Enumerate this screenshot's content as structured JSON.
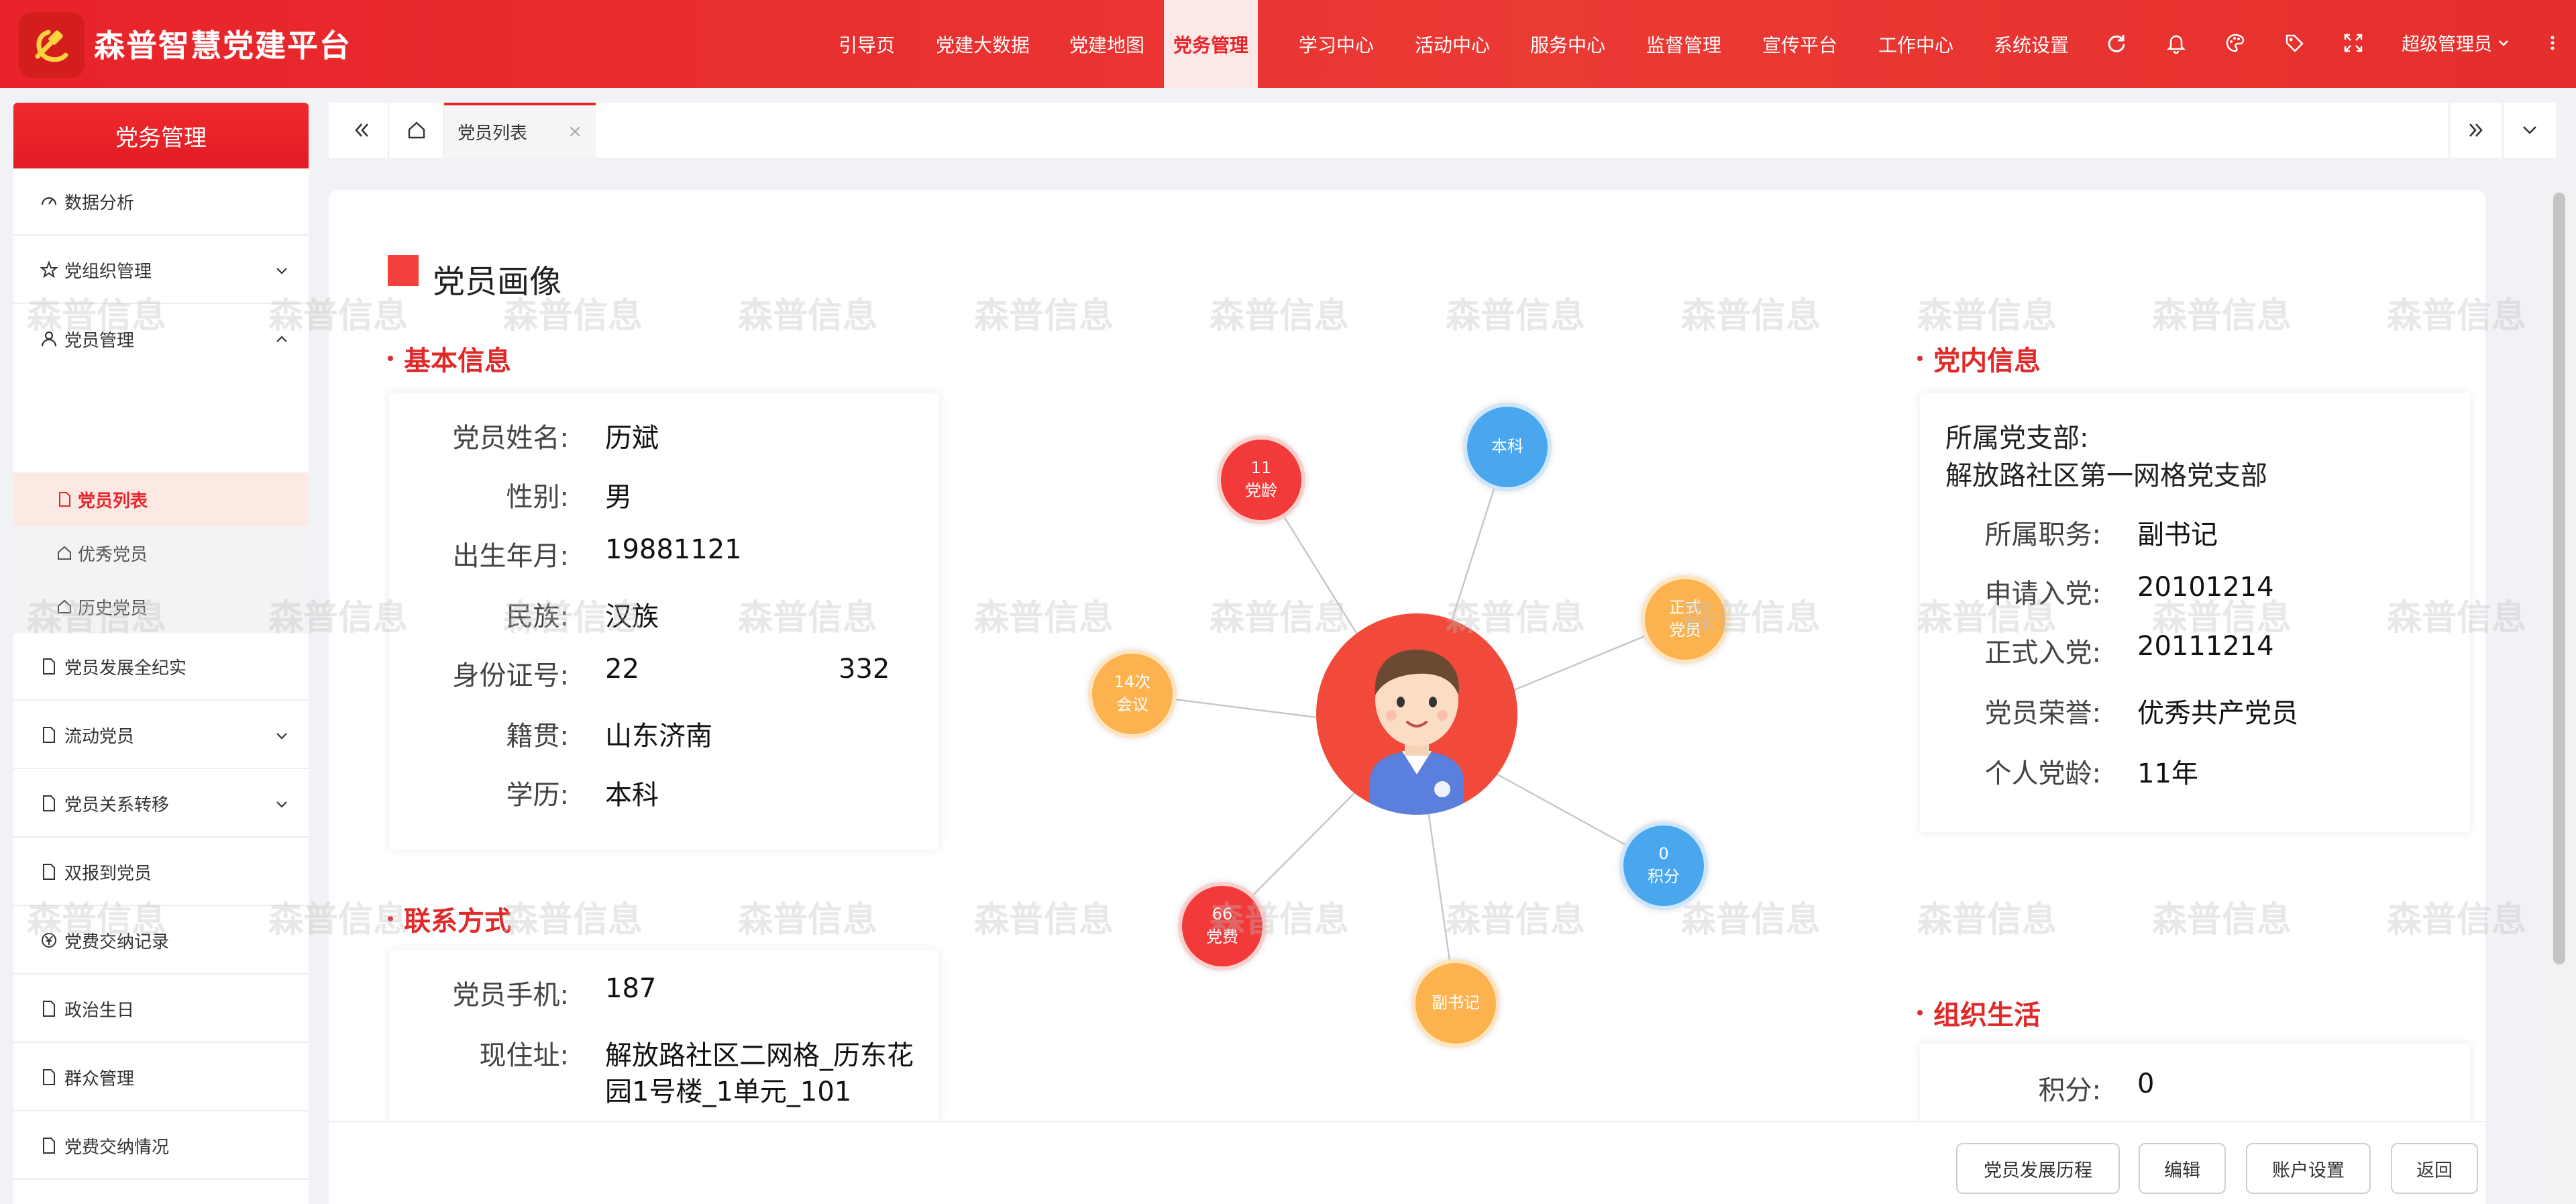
{
  "header": {
    "app_title": "森普智慧党建平台",
    "nav": [
      {
        "label": "引导页"
      },
      {
        "label": "党建大数据"
      },
      {
        "label": "党建地图"
      },
      {
        "label": "党务管理",
        "active": true
      },
      {
        "label": "学习中心"
      },
      {
        "label": "活动中心"
      },
      {
        "label": "服务中心"
      },
      {
        "label": "监督管理"
      },
      {
        "label": "宣传平台"
      },
      {
        "label": "工作中心"
      },
      {
        "label": "系统设置"
      }
    ],
    "icons": [
      "refresh-icon",
      "bell-icon",
      "palette-icon",
      "tag-icon",
      "fullscreen-icon"
    ],
    "user_label": "超级管理员",
    "colors": {
      "primary": "#e8232a",
      "active_bg": "#fde8e8"
    }
  },
  "sidebar": {
    "title": "党务管理",
    "items": [
      {
        "label": "数据分析"
      },
      {
        "label": "党组织管理"
      },
      {
        "label": "党员管理"
      },
      {
        "label": "党员发展全纪实"
      },
      {
        "label": "流动党员"
      },
      {
        "label": "党员关系转移"
      },
      {
        "label": "双报到党员"
      },
      {
        "label": "党费交纳记录"
      },
      {
        "label": "政治生日"
      },
      {
        "label": "群众管理"
      },
      {
        "label": "党费交纳情况"
      }
    ],
    "subitems": [
      {
        "label": "党员列表",
        "active": true
      },
      {
        "label": "优秀党员"
      },
      {
        "label": "历史党员"
      }
    ]
  },
  "tabs": {
    "active_tab": "党员列表",
    "close_glyph": "×"
  },
  "page": {
    "title": "党员画像"
  },
  "basic_info": {
    "title": "基本信息",
    "rows": [
      {
        "label": "党员姓名:",
        "value": "历斌"
      },
      {
        "label": "性别:",
        "value": "男"
      },
      {
        "label": "出生年月:",
        "value": "19881121"
      },
      {
        "label": "民族:",
        "value": "汉族"
      },
      {
        "label": "身份证号:",
        "value": "22",
        "value_tail": "332"
      },
      {
        "label": "籍贯:",
        "value": "山东济南"
      },
      {
        "label": "学历:",
        "value": "本科"
      }
    ]
  },
  "contact": {
    "title": "联系方式",
    "rows": [
      {
        "label": "党员手机:",
        "value": "187"
      },
      {
        "label": "现住址:",
        "value": "解放路社区二网格_历东花",
        "value2": "园1号楼_1单元_101"
      }
    ]
  },
  "party_info": {
    "title": "党内信息",
    "branch_label": "所属党支部:",
    "branch_value": "解放路社区第一网格党支部",
    "rows": [
      {
        "label": "所属职务:",
        "value": "副书记"
      },
      {
        "label": "申请入党:",
        "value": "20101214"
      },
      {
        "label": "正式入党:",
        "value": "20111214"
      },
      {
        "label": "党员荣誉:",
        "value": "优秀共产党员"
      },
      {
        "label": "个人党龄:",
        "value": "11年"
      }
    ]
  },
  "org_life": {
    "title": "组织生活",
    "rows": [
      {
        "label": "积分:",
        "value": "0"
      }
    ]
  },
  "graph": {
    "bubbles": [
      {
        "line1": "11",
        "line2": "党龄",
        "color": "red"
      },
      {
        "line1": "本科",
        "line2": "",
        "color": "blue"
      },
      {
        "line1": "正式",
        "line2": "党员",
        "color": "orange"
      },
      {
        "line1": "14次",
        "line2": "会议",
        "color": "orange"
      },
      {
        "line1": "0",
        "line2": "积分",
        "color": "blue"
      },
      {
        "line1": "66",
        "line2": "党费",
        "color": "red"
      },
      {
        "line1": "副书记",
        "line2": "",
        "color": "orange"
      }
    ]
  },
  "watermark": "森普信息",
  "footer": {
    "buttons": [
      {
        "label": "党员发展历程"
      },
      {
        "label": "编辑"
      },
      {
        "label": "账户设置"
      },
      {
        "label": "返回"
      }
    ]
  }
}
